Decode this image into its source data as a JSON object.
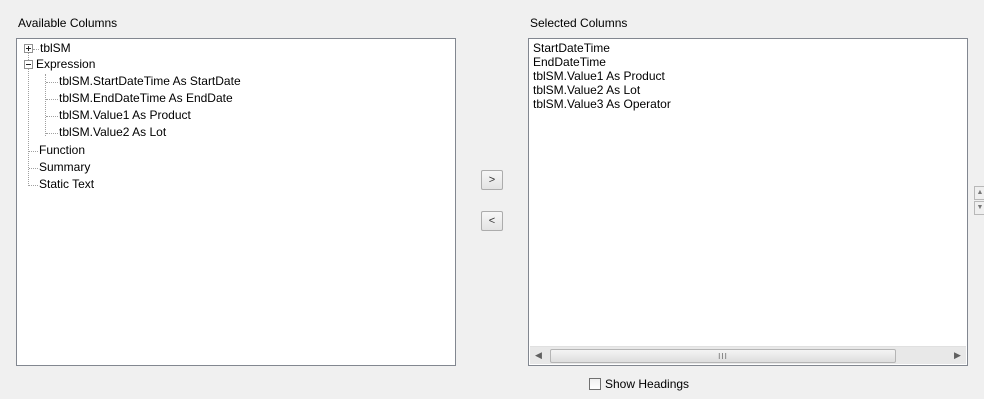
{
  "available": {
    "label": "Available Columns",
    "tree": [
      {
        "label": "tblSM",
        "expander": "plus"
      },
      {
        "label": "Expression",
        "expander": "minus"
      },
      {
        "label": "tblSM.StartDateTime As StartDate"
      },
      {
        "label": "tblSM.EndDateTime As EndDate"
      },
      {
        "label": "tblSM.Value1 As Product"
      },
      {
        "label": "tblSM.Value2 As Lot"
      },
      {
        "label": "Function"
      },
      {
        "label": "Summary"
      },
      {
        "label": "Static Text"
      }
    ]
  },
  "move": {
    "add_label": ">",
    "remove_label": "<"
  },
  "selected": {
    "label": "Selected Columns",
    "items": [
      "StartDateTime",
      "EndDateTime",
      "tblSM.Value1 As Product",
      "tblSM.Value2 As Lot",
      "tblSM.Value3 As Operator"
    ],
    "scroll_left": "◀",
    "scroll_right": "▶",
    "grip": "III"
  },
  "side": {
    "up": "▲",
    "down": "▼"
  },
  "options": {
    "show_headings_label": "Show Headings",
    "show_headings_checked": false
  }
}
